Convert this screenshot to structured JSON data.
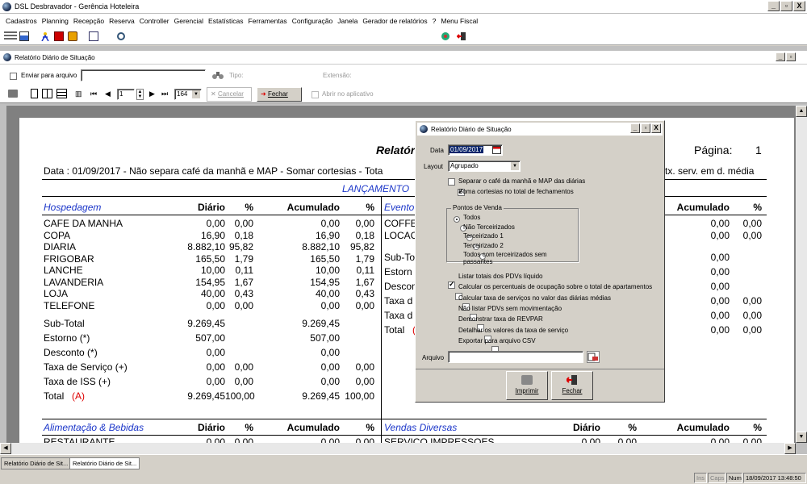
{
  "app": {
    "title": "DSL Desbravador - Gerência Hoteleira"
  },
  "window_controls": [
    "_",
    "▫",
    "X"
  ],
  "menu": [
    "Cadastros",
    "Planning",
    "Recepção",
    "Reserva",
    "Controller",
    "Gerencial",
    "Estatísticas",
    "Ferramentas",
    "Configuração",
    "Janela",
    "Gerador de relatórios",
    "?",
    "Menu Fiscal"
  ],
  "child": {
    "title": "Relatório Diário de Situação"
  },
  "report_toolbar": {
    "send_label": "Enviar para arquivo",
    "type_label": "Tipo:",
    "ext_label": "Extensão:",
    "page_value": "1",
    "zoom_value": "164",
    "cancel_label": "Cancelar",
    "close_label": "Fechar",
    "open_app_label": "Abrir no aplicativo"
  },
  "report": {
    "title": "Relatório",
    "page_label": "Página:",
    "page_number": "1",
    "data_line": "Data : 01/09/2017 - Não separa café da manhã e MAP - Somar cortesias - Tota",
    "data_line_right": "tx. serv. em d. média",
    "section_title": "LANÇAMENTO",
    "hosp": {
      "header": {
        "name": "Hospedagem",
        "diario": "Diário",
        "pct": "%",
        "acum": "Acumulado",
        "pct2": "%"
      },
      "rows": [
        [
          "CAFE DA MANHA",
          "0,00",
          "0,00",
          "0,00",
          "0,00"
        ],
        [
          "COPA",
          "16,90",
          "0,18",
          "16,90",
          "0,18"
        ],
        [
          "DIARIA",
          "8.882,10",
          "95,82",
          "8.882,10",
          "95,82"
        ],
        [
          "FRIGOBAR",
          "165,50",
          "1,79",
          "165,50",
          "1,79"
        ],
        [
          "LANCHE",
          "10,00",
          "0,11",
          "10,00",
          "0,11"
        ],
        [
          "LAVANDERIA",
          "154,95",
          "1,67",
          "154,95",
          "1,67"
        ],
        [
          "LOJA",
          "40,00",
          "0,43",
          "40,00",
          "0,43"
        ],
        [
          "TELEFONE",
          "0,00",
          "0,00",
          "0,00",
          "0,00"
        ]
      ],
      "totals": [
        [
          "Sub-Total",
          "9.269,45",
          "",
          "9.269,45",
          ""
        ],
        [
          "Estorno (*)",
          "507,00",
          "",
          "507,00",
          ""
        ],
        [
          "Desconto (*)",
          "0,00",
          "",
          "0,00",
          ""
        ],
        [
          "Taxa de Serviço (+)",
          "0,00",
          "0,00",
          "0,00",
          "0,00"
        ],
        [
          "Taxa de ISS (+)",
          "0,00",
          "0,00",
          "0,00",
          "0,00"
        ]
      ],
      "total": {
        "label": "Total",
        "marker": "(A)",
        "diario": "9.269,45",
        "pct": "100,00",
        "acum": "9.269,45",
        "pct2": "100,00"
      }
    },
    "eventos": {
      "header": "Evento",
      "acum_header": "Acumulado",
      "pct_header": "%",
      "rows": [
        "COFFE",
        "LOCAC",
        "Sub-To",
        "Estorn",
        "Descon",
        "Taxa d",
        "Taxa d",
        "Total"
      ],
      "total_marker": "(",
      "acum": [
        "0,00",
        "0,00",
        "0,00",
        "0,00",
        "0,00",
        "0,00",
        "0,00",
        "0,00"
      ],
      "pct": [
        "0,00",
        "0,00",
        "",
        "",
        "",
        "0,00",
        "0,00",
        "0,00"
      ]
    },
    "alim": {
      "name": "Alimentação & Bebidas",
      "diario": "Diário",
      "pct": "%",
      "acum": "Acumulado",
      "pct2": "%",
      "cut_row": "RESTAURANTE",
      "cut_vals": [
        "0,00",
        "0,00",
        "0,00",
        "0,00"
      ]
    },
    "vendas": {
      "name": "Vendas Diversas",
      "diario": "Diário",
      "pct": "%",
      "acum": "Acumulado",
      "pct2": "%",
      "cut_row": "SERVICO IMPRESSOES",
      "cut_vals": [
        "0,00",
        "0,00",
        "0,00",
        "0,00"
      ]
    }
  },
  "dialog": {
    "title": "Relatório Diário de Situação",
    "date_label": "Data",
    "date_value": "01/09/2017",
    "layout_label": "Layout",
    "layout_value": "Agrupado",
    "opt_separar": "Separar o café da manhã e MAP das diárias",
    "opt_soma": "Soma cortesias no total de fechamentos",
    "pdv_group": "Pontos de Venda",
    "pdv_options": [
      "Todos",
      "Não Terceirizados",
      "Terceirizado 1",
      "Terceirizado 2",
      "Todos com terceirizados sem passantes"
    ],
    "checks": [
      {
        "label": "Listar totais dos PDVs líquido",
        "checked": true
      },
      {
        "label": "Calcular os percentuais de ocupação sobre o total de apartamentos",
        "checked": false
      },
      {
        "label": "Calcular taxa de serviços no valor das diárias médias",
        "checked": false
      },
      {
        "label": "Não listar PDVs sem movimentação",
        "checked": false
      },
      {
        "label": "Demonstrar taxa de REVPAR",
        "checked": false
      },
      {
        "label": "Detalhar os valores da taxa de serviço",
        "checked": false
      },
      {
        "label": "Exportar para arquivo CSV",
        "checked": false
      }
    ],
    "arquivo_label": "Arquivo",
    "print_label": "Imprimir",
    "close_label": "Fechar"
  },
  "tabs": [
    "Relatório Diário de Sit...",
    "Relatório Diário de Sit..."
  ],
  "status": {
    "ins": "Ins",
    "caps": "Caps",
    "num": "Num",
    "datetime": "18/09/2017 13:48:50"
  }
}
